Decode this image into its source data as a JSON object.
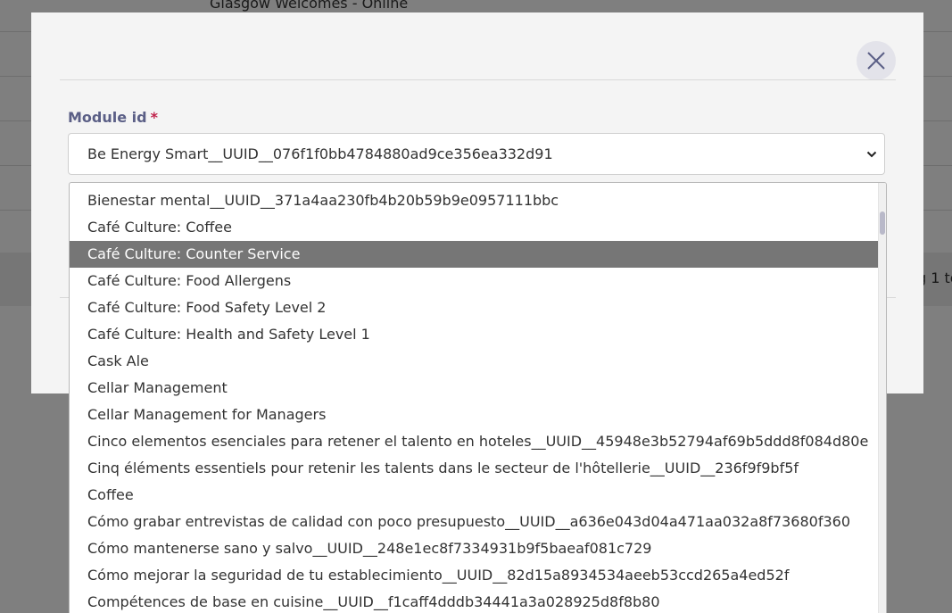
{
  "background": {
    "page_title": "Glasgow Welcomes - Online",
    "right_edge_text": "g 1 to"
  },
  "modal": {
    "close_icon": "close-icon",
    "field": {
      "label": "Module id",
      "required_mark": "*",
      "selected_value": "Be Energy Smart__UUID__076f1f0bb4784880ad9ce356ea332d91"
    },
    "dropdown": {
      "highlighted": "Café Culture: Counter Service",
      "options": [
        "Bienestar mental__UUID__371a4aa230fb4b20b59b9e0957111bbc",
        "Café Culture: Coffee",
        "Café Culture: Counter Service",
        "Café Culture: Food Allergens",
        "Café Culture: Food Safety Level 2",
        "Café Culture: Health and Safety Level 1",
        "Cask Ale",
        "Cellar Management",
        "Cellar Management for Managers",
        "Cinco elementos esenciales para retener el talento en hoteles__UUID__45948e3b52794af69b5ddd8f084d80e",
        "Cinq éléments essentiels pour retenir les talents dans le secteur de l'hôtellerie__UUID__236f9f9bf5f",
        "Coffee",
        "Cómo grabar entrevistas de calidad con poco presupuesto__UUID__a636e043d04a471aa032a8f73680f360",
        "Cómo mantenerse sano y salvo__UUID__248e1ec8f7334931b9f5baeaf081c729",
        "Cómo mejorar la seguridad de tu establecimiento__UUID__82d15a8934534aeeb53ccd265a4ed52f",
        "Compétences de base en cuisine__UUID__f1caff4dddb34441a3a028925d8f8b80"
      ]
    }
  },
  "colors": {
    "label": "#5b5f86",
    "required": "#c0224b",
    "highlight_bg": "#767676",
    "close_button_bg": "#e3e3ea"
  }
}
